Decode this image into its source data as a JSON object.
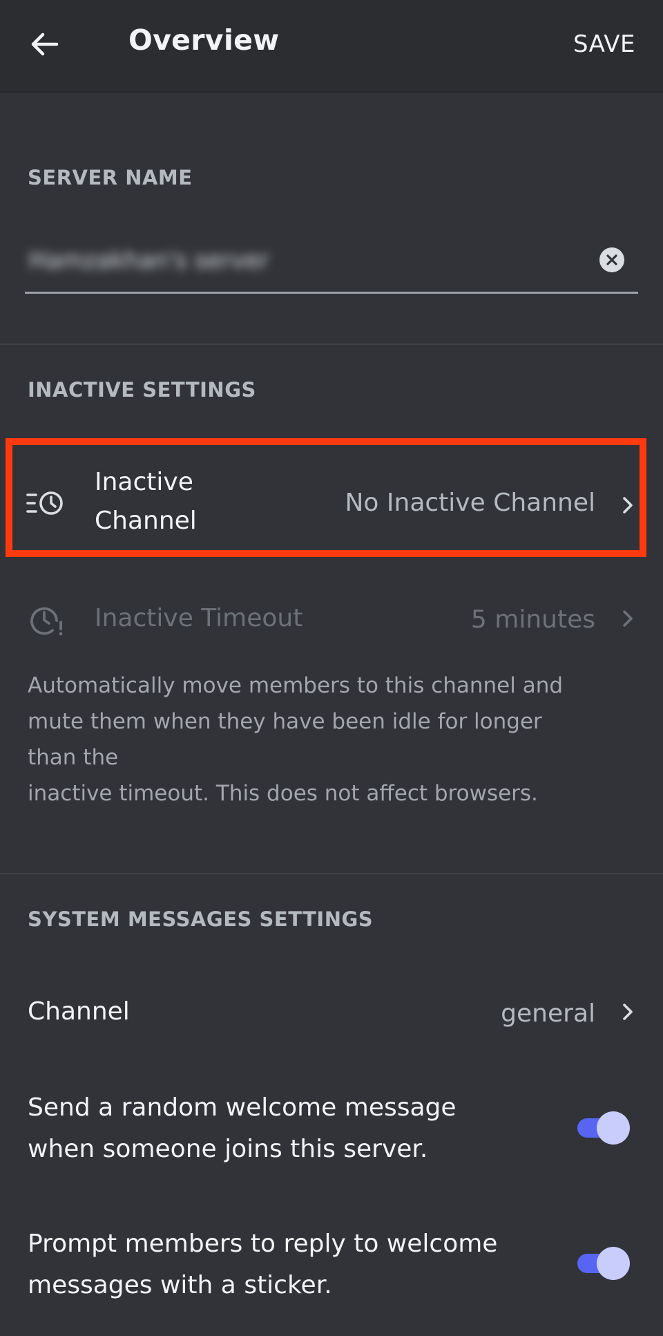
{
  "header": {
    "title": "Overview",
    "save_label": "SAVE"
  },
  "server_name": {
    "section_label": "SERVER NAME",
    "value": "Hamzakhan's server"
  },
  "inactive_settings": {
    "section_label": "INACTIVE SETTINGS",
    "inactive_channel": {
      "label_line1": "Inactive",
      "label_line2": "Channel",
      "value": "No Inactive Channel"
    },
    "inactive_timeout": {
      "label": "Inactive Timeout",
      "value": "5 minutes"
    },
    "help_lines": [
      "Automatically move members to this channel and",
      "mute them when they have been idle for longer",
      "than the",
      "inactive timeout. This does not affect browsers."
    ]
  },
  "system_messages": {
    "section_label": "SYSTEM MESSAGES SETTINGS",
    "channel": {
      "label": "Channel",
      "value": "general"
    },
    "welcome_toggle": {
      "line1": "Send a random welcome message",
      "line2": "when someone joins this server.",
      "enabled": true
    },
    "sticker_toggle": {
      "line1": "Prompt members to reply to welcome",
      "line2": "messages with a sticker.",
      "enabled": true
    }
  },
  "colors": {
    "background": "#313338",
    "header": "#2b2d31",
    "accent": "#5865f2",
    "highlight": "#ff3a0f"
  },
  "icons": {
    "back": "arrow-left-icon",
    "clear": "clear-x-icon",
    "inactive_channel": "list-clock-icon",
    "inactive_timeout": "clock-alert-icon",
    "chevron": "chevron-right-icon"
  }
}
